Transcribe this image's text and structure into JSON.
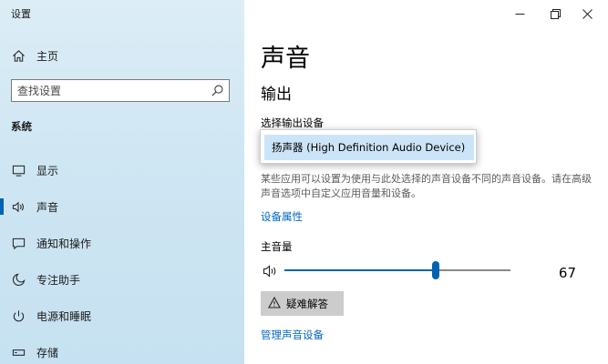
{
  "window": {
    "app_title": "设置",
    "minimize_icon": "minimize-icon",
    "maximize_icon": "restore-icon",
    "close_icon": "close-icon"
  },
  "sidebar": {
    "home": {
      "label": "主页",
      "icon": "home-icon"
    },
    "search": {
      "placeholder": "查找设置",
      "icon": "search-icon"
    },
    "section_title": "系统",
    "items": [
      {
        "label": "显示",
        "icon": "display-icon",
        "selected": false
      },
      {
        "label": "声音",
        "icon": "speaker-icon",
        "selected": true
      },
      {
        "label": "通知和操作",
        "icon": "notification-icon",
        "selected": false
      },
      {
        "label": "专注助手",
        "icon": "moon-icon",
        "selected": false
      },
      {
        "label": "电源和睡眠",
        "icon": "power-icon",
        "selected": false
      },
      {
        "label": "存储",
        "icon": "storage-icon",
        "selected": false
      }
    ]
  },
  "main": {
    "page_title": "声音",
    "output": {
      "section_title": "输出",
      "device_label": "选择输出设备",
      "device_selected": "扬声器 (High Definition Audio Device)",
      "description": "某些应用可以设置为使用与此处选择的声音设备不同的声音设备。请在高级声音选项中自定义应用音量和设备。",
      "device_properties_link": "设备属性",
      "volume_label": "主音量",
      "volume_icon": "volume-icon",
      "volume_value": "67",
      "volume_level": 0.67,
      "troubleshoot_label": "疑难解答",
      "troubleshoot_icon": "warning-icon",
      "manage_devices_link": "管理声音设备"
    }
  },
  "colors": {
    "accent": "#0063b1",
    "link": "#0067c0",
    "nav_background": "#cfe6f3",
    "dropdown_highlight": "#cce4f7",
    "button_gray": "#cccccc"
  }
}
